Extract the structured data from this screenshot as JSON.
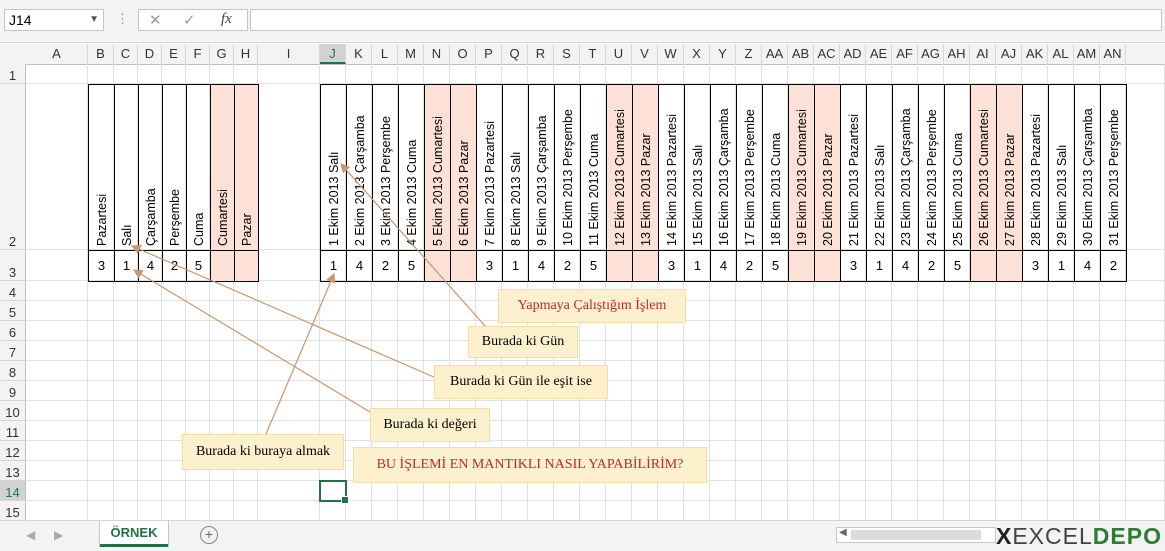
{
  "formula_bar": {
    "name_box": "J14",
    "cancel_icon": "✕",
    "enter_icon": "✓",
    "fx_label": "fx",
    "formula": ""
  },
  "columns": [
    "A",
    "B",
    "C",
    "D",
    "E",
    "F",
    "G",
    "H",
    "I",
    "J",
    "K",
    "L",
    "M",
    "N",
    "O",
    "P",
    "Q",
    "R",
    "S",
    "T",
    "U",
    "V",
    "W",
    "X",
    "Y",
    "Z",
    "AA",
    "AB",
    "AC",
    "AD",
    "AE",
    "AF",
    "AG",
    "AH",
    "AI",
    "AJ",
    "AK",
    "AL",
    "AM",
    "AN"
  ],
  "rows": [
    "1",
    "2",
    "3",
    "4",
    "5",
    "6",
    "7",
    "8",
    "9",
    "10",
    "11",
    "12",
    "13",
    "14",
    "15"
  ],
  "selected_cell": {
    "column": "J",
    "row": "14"
  },
  "weekday_headers": [
    {
      "col": "B",
      "label": "Pazartesi",
      "weekend": false,
      "value": "3"
    },
    {
      "col": "C",
      "label": "Salı",
      "weekend": false,
      "value": "1"
    },
    {
      "col": "D",
      "label": "Çarşamba",
      "weekend": false,
      "value": "4"
    },
    {
      "col": "E",
      "label": "Perşembe",
      "weekend": false,
      "value": "2"
    },
    {
      "col": "F",
      "label": "Cuma",
      "weekend": false,
      "value": "5"
    },
    {
      "col": "G",
      "label": "Cumartesi",
      "weekend": true,
      "value": ""
    },
    {
      "col": "H",
      "label": "Pazar",
      "weekend": true,
      "value": ""
    }
  ],
  "date_headers": [
    {
      "col": "J",
      "label": "1 Ekim 2013 Salı",
      "weekend": false,
      "value": "1"
    },
    {
      "col": "K",
      "label": "2 Ekim 2013 Çarşamba",
      "weekend": false,
      "value": "4"
    },
    {
      "col": "L",
      "label": "3 Ekim 2013 Perşembe",
      "weekend": false,
      "value": "2"
    },
    {
      "col": "M",
      "label": "4 Ekim 2013 Cuma",
      "weekend": false,
      "value": "5"
    },
    {
      "col": "N",
      "label": "5 Ekim 2013 Cumartesi",
      "weekend": true,
      "value": ""
    },
    {
      "col": "O",
      "label": "6 Ekim 2013 Pazar",
      "weekend": true,
      "value": ""
    },
    {
      "col": "P",
      "label": "7 Ekim 2013 Pazartesi",
      "weekend": false,
      "value": "3"
    },
    {
      "col": "Q",
      "label": "8 Ekim 2013 Salı",
      "weekend": false,
      "value": "1"
    },
    {
      "col": "R",
      "label": "9 Ekim 2013 Çarşamba",
      "weekend": false,
      "value": "4"
    },
    {
      "col": "S",
      "label": "10 Ekim 2013 Perşembe",
      "weekend": false,
      "value": "2"
    },
    {
      "col": "T",
      "label": "11 Ekim 2013 Cuma",
      "weekend": false,
      "value": "5"
    },
    {
      "col": "U",
      "label": "12 Ekim 2013 Cumartesi",
      "weekend": true,
      "value": ""
    },
    {
      "col": "V",
      "label": "13 Ekim 2013 Pazar",
      "weekend": true,
      "value": ""
    },
    {
      "col": "W",
      "label": "14 Ekim 2013 Pazartesi",
      "weekend": false,
      "value": "3"
    },
    {
      "col": "X",
      "label": "15 Ekim 2013 Salı",
      "weekend": false,
      "value": "1"
    },
    {
      "col": "Y",
      "label": "16 Ekim 2013 Çarşamba",
      "weekend": false,
      "value": "4"
    },
    {
      "col": "Z",
      "label": "17 Ekim 2013 Perşembe",
      "weekend": false,
      "value": "2"
    },
    {
      "col": "AA",
      "label": "18 Ekim 2013 Cuma",
      "weekend": false,
      "value": "5"
    },
    {
      "col": "AB",
      "label": "19 Ekim 2013 Cumartesi",
      "weekend": true,
      "value": ""
    },
    {
      "col": "AC",
      "label": "20 Ekim 2013 Pazar",
      "weekend": true,
      "value": ""
    },
    {
      "col": "AD",
      "label": "21 Ekim 2013 Pazartesi",
      "weekend": false,
      "value": "3"
    },
    {
      "col": "AE",
      "label": "22 Ekim 2013 Salı",
      "weekend": false,
      "value": "1"
    },
    {
      "col": "AF",
      "label": "23 Ekim 2013 Çarşamba",
      "weekend": false,
      "value": "4"
    },
    {
      "col": "AG",
      "label": "24 Ekim 2013 Perşembe",
      "weekend": false,
      "value": "2"
    },
    {
      "col": "AH",
      "label": "25 Ekim 2013 Cuma",
      "weekend": false,
      "value": "5"
    },
    {
      "col": "AI",
      "label": "26 Ekim 2013 Cumartesi",
      "weekend": true,
      "value": ""
    },
    {
      "col": "AJ",
      "label": "27 Ekim 2013 Pazar",
      "weekend": true,
      "value": ""
    },
    {
      "col": "AK",
      "label": "28 Ekim 2013 Pazartesi",
      "weekend": false,
      "value": "3"
    },
    {
      "col": "AL",
      "label": "29 Ekim 2013 Salı",
      "weekend": false,
      "value": "1"
    },
    {
      "col": "AM",
      "label": "30 Ekim 2013 Çarşamba",
      "weekend": false,
      "value": "4"
    },
    {
      "col": "AN",
      "label": "31 Ekim 2013 Perşembe",
      "weekend": false,
      "value": "2"
    }
  ],
  "callouts": {
    "title": "Yapmaya Çalıştığım İşlem",
    "gun": "Burada ki Gün",
    "gun_esit": "Burada ki Gün ile eşit ise",
    "degeri": "Burada ki değeri",
    "buraya": "Burada ki buraya almak",
    "question": "BU İŞLEMİ EN MANTIKLI NASIL YAPABİLİRİM?"
  },
  "sheet_tabs": [
    "ÖRNEK"
  ],
  "add_sheet_icon": "+",
  "logo": {
    "x": "X",
    "excel": "EXCEL",
    "depo": "DEPO"
  },
  "colors": {
    "weekend_fill": "#fde1d6",
    "callout_fill": "#fdf0cc",
    "arrow": "#c9956b",
    "accent": "#217346",
    "question_text": "#c0272d"
  }
}
